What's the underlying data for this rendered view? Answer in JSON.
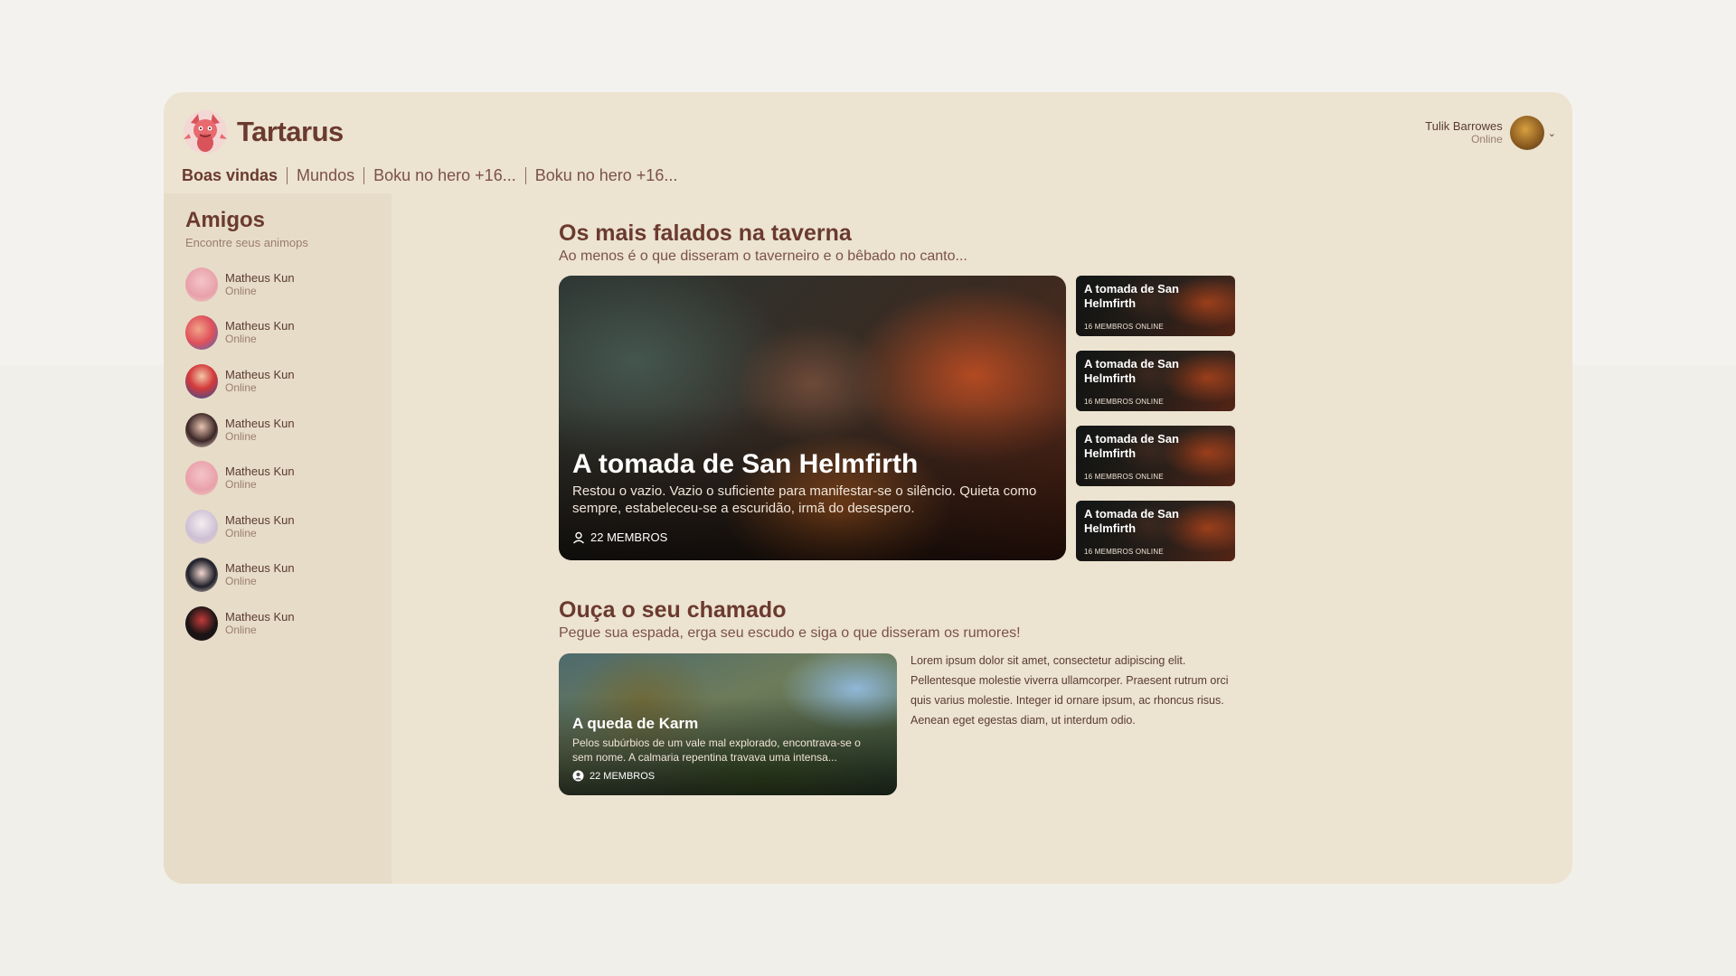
{
  "app": {
    "name": "Tartarus"
  },
  "tabs": [
    "Boas vindas",
    "Mundos",
    "Boku no hero +16...",
    "Boku no hero +16..."
  ],
  "user": {
    "name": "Tulik Barrowes",
    "status": "Online"
  },
  "sidebar": {
    "title": "Amigos",
    "subtitle": "Encontre seus animops",
    "friends": [
      {
        "name": "Matheus Kun",
        "status": "Online"
      },
      {
        "name": "Matheus Kun",
        "status": "Online"
      },
      {
        "name": "Matheus Kun",
        "status": "Online"
      },
      {
        "name": "Matheus Kun",
        "status": "Online"
      },
      {
        "name": "Matheus Kun",
        "status": "Online"
      },
      {
        "name": "Matheus Kun",
        "status": "Online"
      },
      {
        "name": "Matheus Kun",
        "status": "Online"
      },
      {
        "name": "Matheus Kun",
        "status": "Online"
      }
    ]
  },
  "section1": {
    "title": "Os mais falados na taverna",
    "subtitle": "Ao menos é o que disseram o taverneiro e o bêbado no canto...",
    "feature": {
      "title": "A tomada de San Helmfirth",
      "description": "Restou o vazio. Vazio o suficiente para manifestar-se o silêncio. Quieta como sempre, estabeleceu-se a escuridão, irmã do desespero.",
      "members": "22 MEMBROS"
    },
    "thumbs": [
      {
        "title": "A tomada de San Helmfirth",
        "meta": "16 MEMBROS ONLINE"
      },
      {
        "title": "A tomada de San Helmfirth",
        "meta": "16 MEMBROS ONLINE"
      },
      {
        "title": "A tomada de San Helmfirth",
        "meta": "16 MEMBROS ONLINE"
      },
      {
        "title": "A tomada de San Helmfirth",
        "meta": "16 MEMBROS ONLINE"
      }
    ]
  },
  "section2": {
    "title": "Ouça o seu chamado",
    "subtitle": "Pegue sua espada, erga seu escudo e siga o que disseram os rumores!",
    "card": {
      "title": "A queda de Karm",
      "description": "Pelos subúrbios de um vale mal explorado, encontrava-se o sem nome. A calmaria repentina travava uma intensa...",
      "members": "22 MEMBROS"
    },
    "lorem": "Lorem ipsum dolor sit amet, consectetur adipiscing elit. Pellentesque molestie viverra ullamcorper. Praesent rutrum orci quis varius molestie. Integer id ornare ipsum, ac rhoncus risus. Aenean eget egestas diam, ut interdum odio."
  },
  "colors": {
    "accent": "#6b3a2e",
    "panel": "#ece3d1",
    "sidebar": "#e7dcc8",
    "background": "#f4f2ee"
  }
}
